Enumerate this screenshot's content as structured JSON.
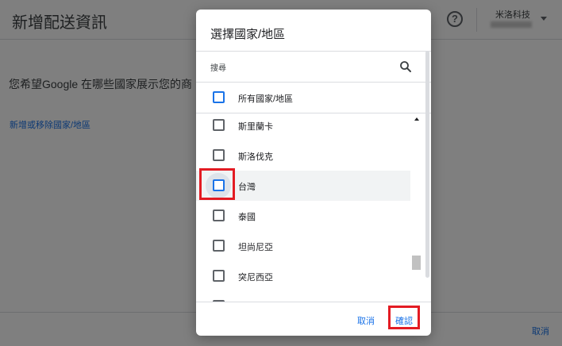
{
  "background": {
    "title": "新增配送資訊",
    "account_name": "米洛科技",
    "question": "您希望Google 在哪些國家展示您的商",
    "link": "新增或移除國家/地區",
    "cancel": "取消"
  },
  "dialog": {
    "title": "選擇國家/地區",
    "search_placeholder": "搜尋",
    "all_label": "所有國家/地區",
    "items": [
      {
        "label": "斯里蘭卡",
        "checked": false
      },
      {
        "label": "斯洛伐克",
        "checked": false
      },
      {
        "label": "台灣",
        "checked": false,
        "highlighted": true
      },
      {
        "label": "泰國",
        "checked": false
      },
      {
        "label": "坦尚尼亞",
        "checked": false
      },
      {
        "label": "突尼西亞",
        "checked": false
      },
      {
        "label": "",
        "checked": false
      }
    ],
    "cancel_label": "取消",
    "confirm_label": "確認"
  },
  "colors": {
    "accent": "#1a73e8",
    "annotation": "#e31b23",
    "scrim": "rgba(0,0,0,0.5)"
  }
}
